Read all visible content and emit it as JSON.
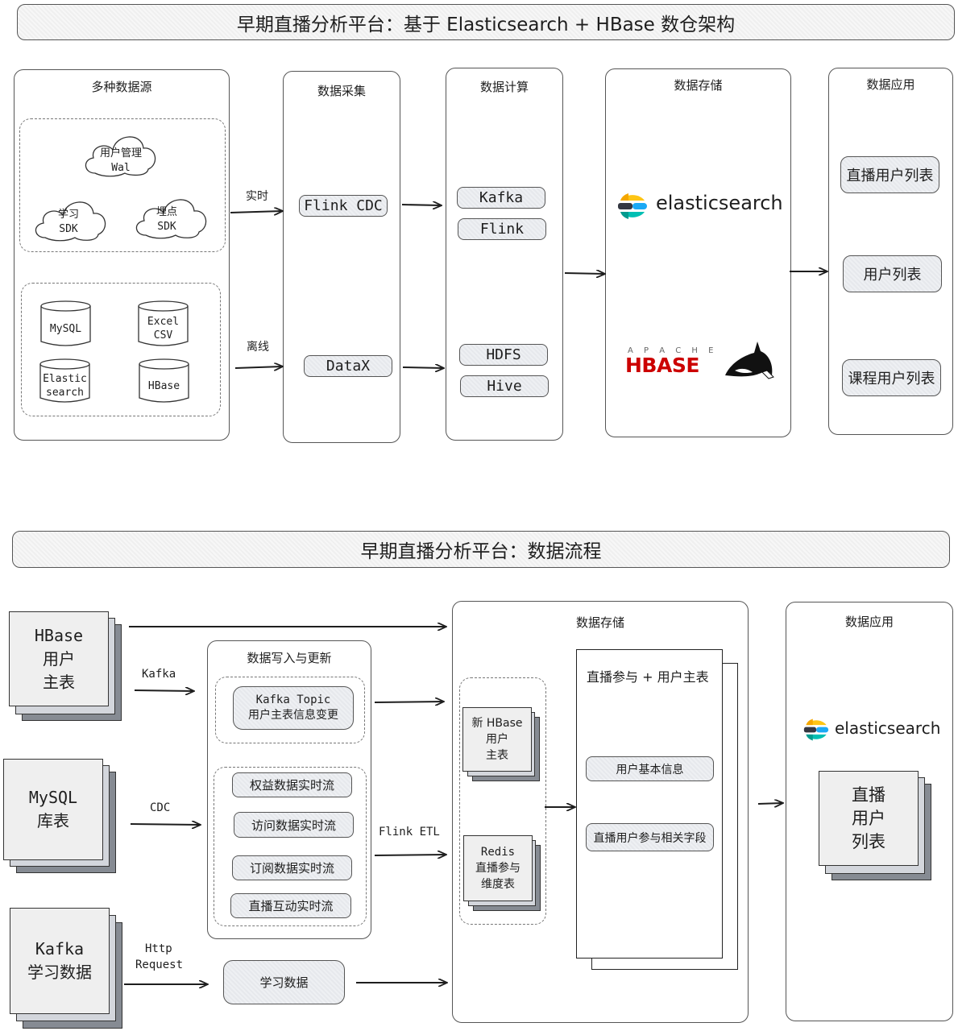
{
  "top_section": {
    "title": "早期直播分析平台：基于 Elasticsearch + HBase 数仓架构",
    "sources": {
      "title": "多种数据源",
      "clouds": [
        {
          "line1": "用户管理",
          "line2": "Wal"
        },
        {
          "line1": "学习",
          "line2": "SDK"
        },
        {
          "line1": "埋点",
          "line2": "SDK"
        }
      ],
      "databases": [
        {
          "line1": "MySQL",
          "line2": ""
        },
        {
          "line1": "Excel",
          "line2": "CSV"
        },
        {
          "line1": "Elastic",
          "line2": "search"
        },
        {
          "line1": "HBase",
          "line2": ""
        }
      ]
    },
    "arrow_labels": {
      "realtime": "实时",
      "offline": "离线"
    },
    "collection": {
      "title": "数据采集",
      "items": [
        "Flink CDC",
        "DataX"
      ]
    },
    "compute": {
      "title": "数据计算",
      "items": [
        "Kafka",
        "Flink",
        "HDFS",
        "Hive"
      ]
    },
    "storage": {
      "title": "数据存储",
      "elasticsearch_logo": "elasticsearch",
      "hbase_logo": {
        "apache": "A P A C H E",
        "name": "HBASE"
      }
    },
    "application": {
      "title": "数据应用",
      "items": [
        "直播用户列表",
        "用户列表",
        "课程用户列表"
      ]
    }
  },
  "bottom_section": {
    "title": "早期直播分析平台：数据流程",
    "sources": [
      {
        "line1": "HBase",
        "line2": "用户",
        "line3": "主表"
      },
      {
        "line1": "MySQL",
        "line2": "库表",
        "line3": ""
      },
      {
        "line1": "Kafka",
        "line2": "学习数据",
        "line3": ""
      }
    ],
    "arrow_labels": {
      "kafka": "Kafka",
      "cdc": "CDC",
      "http1": "Http",
      "http2": "Request",
      "flink_etl": "Flink ETL"
    },
    "write_update": {
      "title": "数据写入与更新",
      "topic": {
        "line1": "Kafka Topic",
        "line2": "用户主表信息变更"
      },
      "streams": [
        "权益数据实时流",
        "访问数据实时流",
        "订阅数据实时流",
        "直播互动实时流"
      ]
    },
    "learning_data": "学习数据",
    "storage": {
      "title": "数据存储",
      "tables": [
        {
          "line1": "新 HBase",
          "line2": "用户",
          "line3": "主表"
        },
        {
          "line1": "Redis",
          "line2": "直播参与",
          "line3": "维度表"
        }
      ],
      "joined_table": {
        "title": "直播参与 + 用户主表",
        "fields": [
          "用户基本信息",
          "直播用户参与相关字段"
        ]
      }
    },
    "application": {
      "title": "数据应用",
      "elasticsearch_logo": "elasticsearch",
      "result": {
        "line1": "直播",
        "line2": "用户",
        "line3": "列表"
      }
    }
  },
  "colors": {
    "es_yellow": "#fec514",
    "es_teal": "#00bfb3",
    "es_blue": "#1ba9f5",
    "es_dark": "#343741",
    "es_orange": "#f04e98",
    "hbase_red": "#cc0000"
  }
}
